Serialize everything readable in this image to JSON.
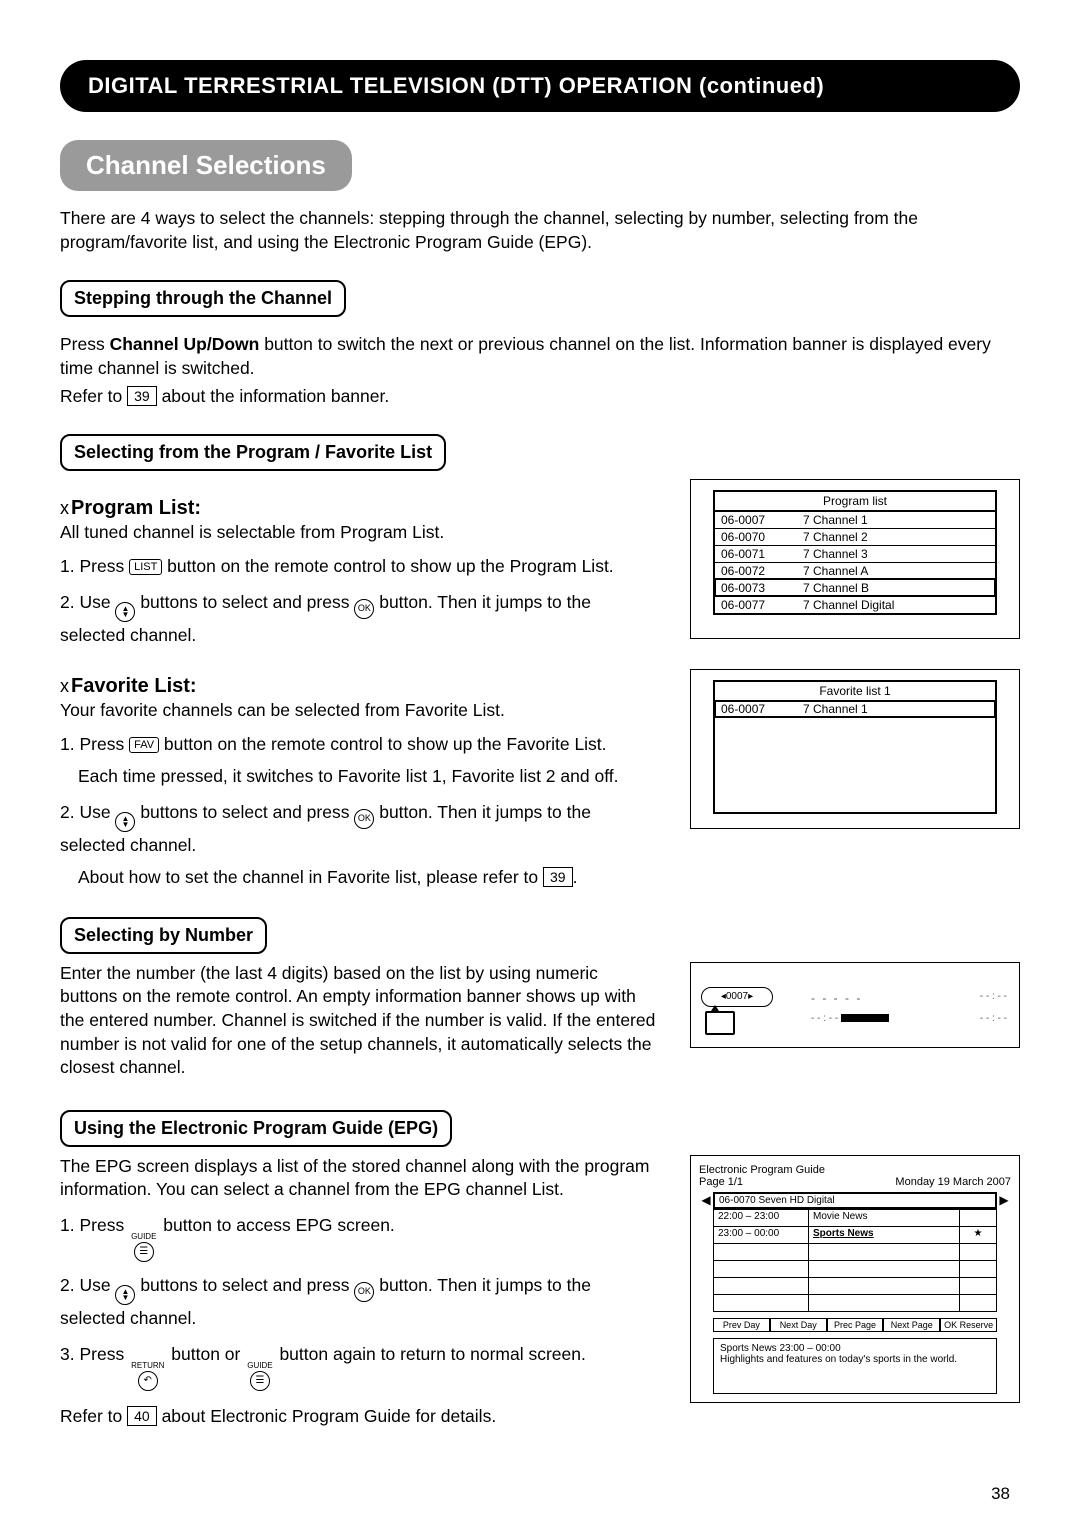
{
  "page_number": "38",
  "title": "DIGITAL TERRESTRIAL TELEVISION (DTT) OPERATION (continued)",
  "section": "Channel Selections",
  "intro": "There are 4 ways to select the channels: stepping through the channel, selecting by number, selecting from the program/favorite list, and using the Electronic Program Guide (EPG).",
  "stepping": {
    "heading": "Stepping through the Channel",
    "p1a": "Press ",
    "p1b": "Channel Up/Down",
    "p1c": " button to switch the next or previous channel on the list. Information banner is displayed every time channel is switched.",
    "p2a": "Refer to ",
    "p2ref": "39",
    "p2b": " about the information banner."
  },
  "selectList": {
    "heading": "Selecting from the Program / Favorite List",
    "programHead": "Program List:",
    "programIntro": "All tuned channel is selectable from Program List.",
    "p_step1a": "Press ",
    "p_btn_list": "LIST",
    "p_step1b": " button on the remote control to show up the Program List.",
    "p_step2a": "Use ",
    "p_step2b": " buttons to select and press ",
    "p_step2c": " button. Then it jumps to the selected channel.",
    "favHead": "Favorite List:",
    "favIntro": "Your favorite channels can be selected from Favorite List.",
    "f_step1a": "Press ",
    "f_btn_fav": "FAV",
    "f_step1b": " button on the remote control to show up the Favorite List.",
    "f_step1c": "Each time pressed, it switches to Favorite list 1, Favorite list 2 and off.",
    "f_step2a": "Use ",
    "f_step2b": " buttons to select and press ",
    "f_step2c": " button. Then it jumps to the selected channel.",
    "f_step2d_a": "About how to set the channel in Favorite list, please refer to ",
    "f_step2d_ref": "39",
    "f_step2d_b": "."
  },
  "byNumber": {
    "heading": "Selecting by Number",
    "text": "Enter the number (the last 4 digits) based on the list by using numeric buttons on the remote control. An empty information banner shows up with the entered number. Channel is switched if the number is valid. If the entered number is not valid for one of the setup channels, it automatically selects the closest channel."
  },
  "epg": {
    "heading": "Using the Electronic Program Guide (EPG)",
    "intro": "The EPG screen displays a list of the stored channel along with the program information. You can select a channel from the EPG channel List.",
    "s1a": "Press ",
    "guide_label": "GUIDE",
    "s1b": " button to access EPG screen.",
    "s2a": "Use ",
    "s2b": " buttons to select and press ",
    "s2c": " button. Then it jumps to the selected channel.",
    "s3a": "Press ",
    "return_label": "RETURN",
    "s3b": " button or ",
    "s3c": " button again to return to normal screen.",
    "s4a": "Refer to ",
    "s4ref": "40",
    "s4b": " about Electronic Program Guide for details."
  },
  "fig_program": {
    "title": "Program list",
    "rows": [
      {
        "id": "06-0007",
        "name": "7 Channel 1"
      },
      {
        "id": "06-0070",
        "name": "7 Channel 2"
      },
      {
        "id": "06-0071",
        "name": "7 Channel 3"
      },
      {
        "id": "06-0072",
        "name": "7 Channel A"
      },
      {
        "id": "06-0073",
        "name": "7 Channel B"
      },
      {
        "id": "06-0077",
        "name": "7 Channel Digital"
      }
    ],
    "selected_index": 4
  },
  "fig_fav": {
    "title": "Favorite list 1",
    "rows": [
      {
        "id": "06-0007",
        "name": "7 Channel 1"
      }
    ]
  },
  "fig_banner": {
    "channel_no": "0007",
    "dash": "- - - - -",
    "time_a": "- - : - -",
    "time_b": "- - : - -",
    "r1": "- - : - -",
    "r2": "- - : - -"
  },
  "fig_epg": {
    "title": "Electronic Program Guide",
    "page": "Page 1/1",
    "date": "Monday 19 March 2007",
    "channel": "06-0070 Seven HD Digital",
    "rows": [
      {
        "time": "22:00 – 23:00",
        "prog": "Movie News",
        "star": ""
      },
      {
        "time": "23:00 – 00:00",
        "prog": "Sports News",
        "star": "★"
      }
    ],
    "empty_rows": 4,
    "buttons": [
      "Prev Day",
      "Next Day",
      "Prec Page",
      "Next Page",
      "OK Reserve"
    ],
    "desc1": "Sports News 23:00 – 00:00",
    "desc2": "Highlights and features on today's sports in the world."
  },
  "ok_label": "OK",
  "arrow_up": "▲",
  "arrow_down": "▼"
}
